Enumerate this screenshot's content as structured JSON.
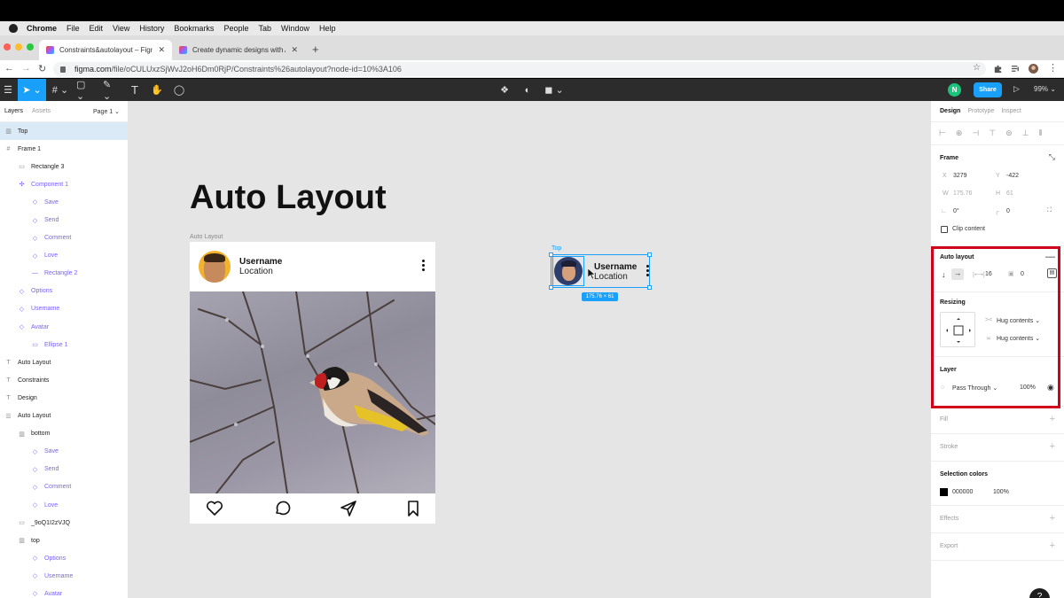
{
  "mac_menu": [
    "File",
    "Edit",
    "View",
    "History",
    "Bookmarks",
    "People",
    "Tab",
    "Window",
    "Help"
  ],
  "mac_app": "Chrome",
  "tabs": [
    {
      "title": "Constraints&autolayout – Figm"
    },
    {
      "title": "Create dynamic designs with A"
    }
  ],
  "address": {
    "host": "figma.com",
    "path": "/file/oCULUxzSjWvJ2oH6Dm0RjP/Constraints%26autolayout?node-id=10%3A106"
  },
  "toolbar": {
    "user_initial": "N",
    "share_label": "Share",
    "zoom": "99%"
  },
  "layers_panel": {
    "tab_layers": "Layers",
    "tab_assets": "Assets",
    "page": "Page 1",
    "items": [
      {
        "label": "Top",
        "glyph": "▥",
        "indent": 0,
        "kind": "selected"
      },
      {
        "label": "Frame 1",
        "glyph": "#",
        "indent": 0,
        "kind": "frame"
      },
      {
        "label": "Rectangle 3",
        "glyph": "▭",
        "indent": 1,
        "kind": "normal"
      },
      {
        "label": "Component 1",
        "glyph": "✣",
        "indent": 1,
        "kind": "comp"
      },
      {
        "label": "Save",
        "glyph": "◇",
        "indent": 2,
        "kind": "comp"
      },
      {
        "label": "Send",
        "glyph": "◇",
        "indent": 2,
        "kind": "comp"
      },
      {
        "label": "Comment",
        "glyph": "◇",
        "indent": 2,
        "kind": "comp"
      },
      {
        "label": "Love",
        "glyph": "◇",
        "indent": 2,
        "kind": "comp"
      },
      {
        "label": "Rectangle 2",
        "glyph": "—",
        "indent": 2,
        "kind": "comp"
      },
      {
        "label": "Options",
        "glyph": "◇",
        "indent": 1,
        "kind": "comp"
      },
      {
        "label": "Username",
        "glyph": "◇",
        "indent": 1,
        "kind": "comp"
      },
      {
        "label": "Avatar",
        "glyph": "◇",
        "indent": 1,
        "kind": "comp"
      },
      {
        "label": "Ellipse 1",
        "glyph": "▭",
        "indent": 2,
        "kind": "comp"
      },
      {
        "label": "Auto Layout",
        "glyph": "T",
        "indent": 0,
        "kind": "normal"
      },
      {
        "label": "Constraints",
        "glyph": "T",
        "indent": 0,
        "kind": "normal"
      },
      {
        "label": "Design",
        "glyph": "T",
        "indent": 0,
        "kind": "normal"
      },
      {
        "label": "Auto Layout",
        "glyph": "☰",
        "indent": 0,
        "kind": "frame"
      },
      {
        "label": "bottom",
        "glyph": "▥",
        "indent": 1,
        "kind": "normal"
      },
      {
        "label": "Save",
        "glyph": "◇",
        "indent": 2,
        "kind": "comp"
      },
      {
        "label": "Send",
        "glyph": "◇",
        "indent": 2,
        "kind": "comp"
      },
      {
        "label": "Comment",
        "glyph": "◇",
        "indent": 2,
        "kind": "comp"
      },
      {
        "label": "Love",
        "glyph": "◇",
        "indent": 2,
        "kind": "comp"
      },
      {
        "label": "_9oQ1I2zVJQ",
        "glyph": "▭",
        "indent": 1,
        "kind": "normal"
      },
      {
        "label": "top",
        "glyph": "▥",
        "indent": 1,
        "kind": "normal"
      },
      {
        "label": "Options",
        "glyph": "◇",
        "indent": 2,
        "kind": "comp"
      },
      {
        "label": "Username",
        "glyph": "◇",
        "indent": 2,
        "kind": "comp"
      },
      {
        "label": "Avatar",
        "glyph": "◇",
        "indent": 2,
        "kind": "comp"
      }
    ]
  },
  "canvas": {
    "title": "Auto Layout",
    "frame_label": "Auto Layout",
    "card": {
      "username": "Username",
      "location": "Location"
    },
    "selection": {
      "label": "Top",
      "username": "Username",
      "location": "Location",
      "size_badge": "175.76 × 61"
    }
  },
  "design_panel": {
    "tab_design": "Design",
    "tab_prototype": "Prototype",
    "tab_inspect": "Inspect",
    "frame": {
      "title": "Frame",
      "x_label": "X",
      "x": "3279",
      "y_label": "Y",
      "y": "-422",
      "w_label": "W",
      "w": "175.76",
      "h_label": "H",
      "h": "61",
      "rotation": "0°",
      "radius": "0",
      "clip_content": "Clip content"
    },
    "auto_layout": {
      "title": "Auto layout",
      "spacing": "16",
      "padding": "0"
    },
    "resizing": {
      "title": "Resizing",
      "horizontal": "Hug contents",
      "vertical": "Hug contents"
    },
    "layer": {
      "title": "Layer",
      "blend": "Pass Through",
      "opacity": "100%"
    },
    "fill": {
      "title": "Fill"
    },
    "stroke": {
      "title": "Stroke"
    },
    "selection_colors": {
      "title": "Selection colors",
      "hex": "000000",
      "opacity": "100%"
    },
    "effects": {
      "title": "Effects"
    },
    "export": {
      "title": "Export"
    }
  },
  "colors": {
    "accent": "#18a0fb",
    "highlight": "#d0021b",
    "component": "#7b61ff"
  }
}
